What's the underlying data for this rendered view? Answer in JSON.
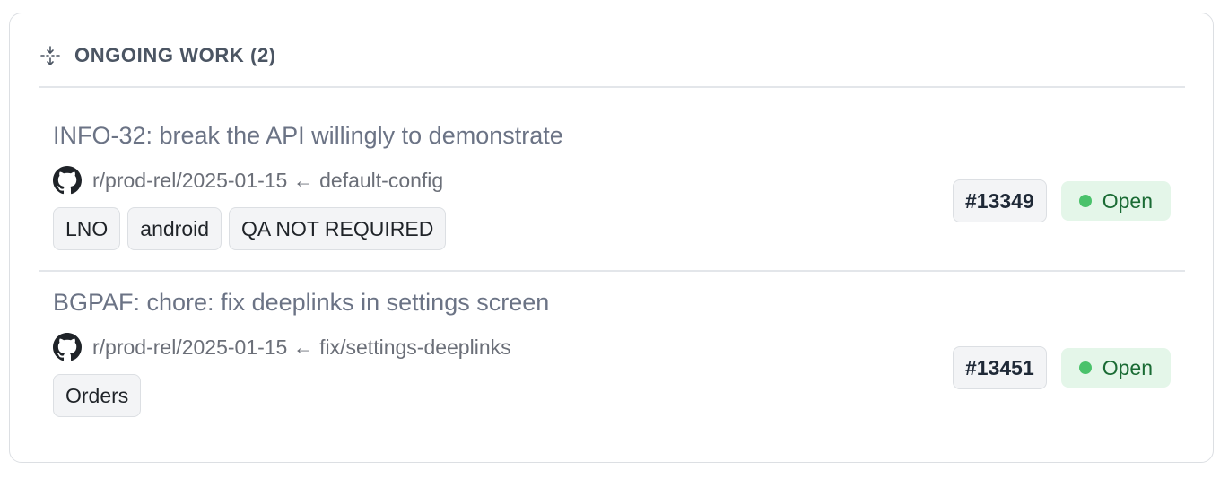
{
  "section": {
    "title": "ONGOING WORK (2)",
    "icon": "collapse-vertical-icon"
  },
  "items": [
    {
      "title": "INFO-32: break the API willingly to demonstrate",
      "branch": "r/prod-rel/2025-01-15 ← default-config",
      "tags": [
        "LNO",
        "android",
        "QA NOT REQUIRED"
      ],
      "pr_number": "#13349",
      "status": "Open"
    },
    {
      "title": "BGPAF: chore: fix deeplinks in settings screen",
      "branch": "r/prod-rel/2025-01-15 ← fix/settings-deeplinks",
      "tags": [
        "Orders"
      ],
      "pr_number": "#13451",
      "status": "Open"
    }
  ],
  "colors": {
    "status_open_bg": "#e4f6e9",
    "status_open_dot": "#4ac26b",
    "status_open_text": "#1a6b34"
  }
}
